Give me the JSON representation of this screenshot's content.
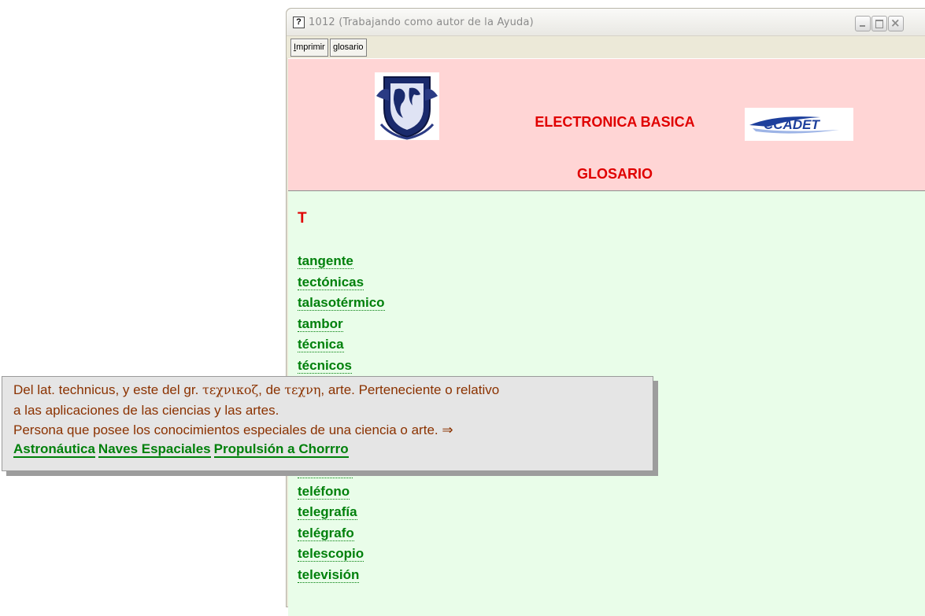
{
  "window": {
    "icon_glyph": "?",
    "title": "1012  (Trabajando como autor de la Ayuda)",
    "controls": {
      "minimize": "minimize-icon",
      "maximize": "maximize-icon",
      "close": "close-icon"
    }
  },
  "toolbar": {
    "print_mnemonic": "I",
    "print_rest": "mprimir",
    "glossary_mnemonic": "g",
    "glossary_rest": "losario"
  },
  "header": {
    "title": "ELECTRONICA BASICA",
    "subtitle": "GLOSARIO",
    "logo_left": "unam-crest-logo",
    "logo_right": "ccadet-logo",
    "logo_right_text": "CCADET"
  },
  "content": {
    "letter": "T",
    "terms": [
      "tangente",
      "tectónicas",
      "talasotérmico",
      "tambor",
      "técnica",
      "técnicos",
      "",
      "",
      "",
      "",
      "telefonía",
      "teléfono",
      "telegrafía",
      "telégrafo",
      "telescopio",
      "televisión"
    ]
  },
  "popup": {
    "line1_a": "Del lat. technicus, y este del gr. ",
    "greek1": "τεχνικοζ",
    "line1_b": ", de ",
    "greek2": "τεχνη",
    "line1_c": ", arte. Perteneciente o relativo",
    "line2": "a las aplicaciones de las ciencias y las artes.",
    "line3": "Persona que posee los conocimientos especiales de una ciencia o arte. ⇒",
    "links": [
      "Astronáutica",
      "Naves Espaciales",
      "Propulsión a Chorrro"
    ]
  },
  "colors": {
    "header_bg": "#ffd5d5",
    "content_bg": "#e9fde9",
    "title_red": "#e00000",
    "link_green": "#00800b",
    "popup_text": "#8b3200"
  }
}
